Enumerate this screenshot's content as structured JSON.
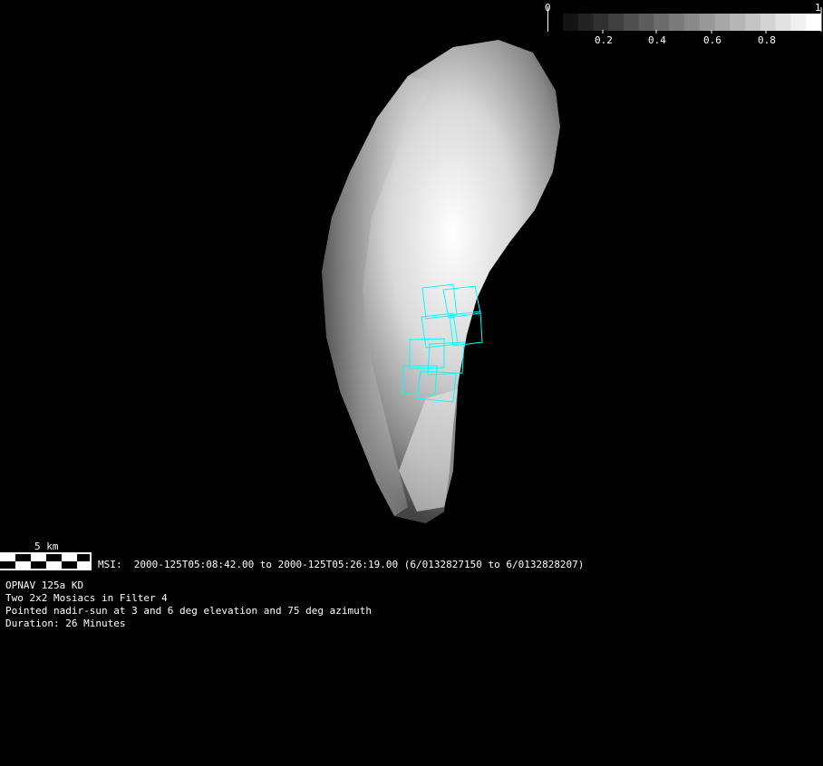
{
  "colorbar": {
    "min_label": "0",
    "max_label": "1",
    "tick_labels": [
      "0.2",
      "0.4",
      "0.6",
      "0.8"
    ],
    "steps": 17
  },
  "scale_bar": {
    "label": "5 km"
  },
  "msi_line": "MSI:  2000-125T05:08:42.00 to 2000-125T05:26:19.00 (6/0132827150 to 6/0132828207)",
  "info_lines": [
    "OPNAV 125a KD",
    "Two 2x2 Mosiacs in Filter 4",
    "Pointed nadir-sun at 3 and 6 deg elevation and 75 deg azimuth",
    "Duration: 26 Minutes"
  ],
  "colors": {
    "footprint": "#00ffff",
    "background": "#000000"
  }
}
